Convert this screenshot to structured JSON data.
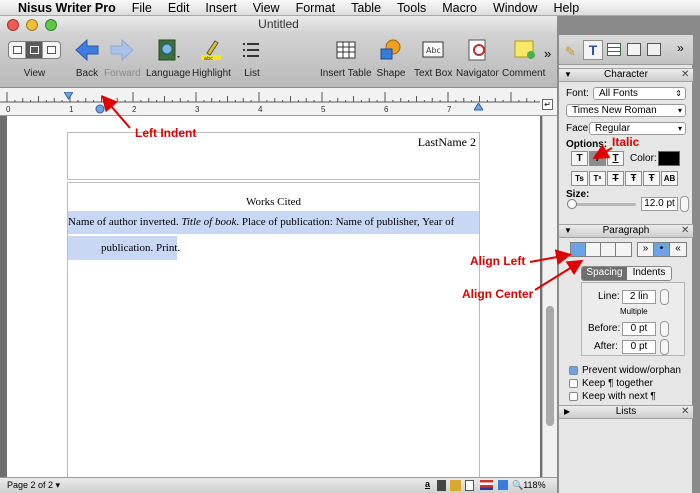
{
  "menubar": {
    "app_name": "Nisus Writer Pro",
    "items": [
      "File",
      "Edit",
      "Insert",
      "View",
      "Format",
      "Table",
      "Tools",
      "Macro",
      "Window",
      "Help"
    ]
  },
  "window": {
    "title": "Untitled",
    "toolbar": {
      "view": "View",
      "back": "Back",
      "forward": "Forward",
      "language": "Language",
      "highlight": "Highlight",
      "list": "List",
      "insert_table": "Insert Table",
      "shape": "Shape",
      "text_box": "Text Box",
      "navigator": "Navigator",
      "comment": "Comment",
      "overflow": "»"
    },
    "ruler_numbers": [
      "0",
      "1",
      "2",
      "3",
      "4",
      "5",
      "6",
      "7"
    ],
    "document": {
      "header_text": "LastName 2",
      "heading": "Works Cited",
      "citation_line1_a": "Name of author inverted. ",
      "citation_line1_title": "Title of book",
      "citation_line1_b": ". Place of publication: Name of publisher, Year of",
      "citation_line2": "publication. Print."
    },
    "status": {
      "page": "Page 2 of 2",
      "zoom": "118%"
    }
  },
  "panel": {
    "character": {
      "title": "Character",
      "font_label": "Font:",
      "font_collection": "All Fonts",
      "font_name": "Times New Roman",
      "face_label": "Face:",
      "face_value": "Regular",
      "options_label": "Options:",
      "color_label": "Color:",
      "size_label": "Size:",
      "size_value": "12.0 pt"
    },
    "paragraph": {
      "title": "Paragraph",
      "tab_spacing": "Spacing",
      "tab_indents": "Indents",
      "line_label": "Line:",
      "line_value": "2 lin",
      "line_mode": "Multiple",
      "before_label": "Before:",
      "before_value": "0 pt",
      "after_label": "After:",
      "after_value": "0 pt",
      "prevent_widow": "Prevent widow/orphan",
      "keep_together": "Keep ¶ together",
      "keep_next": "Keep with next ¶"
    },
    "lists": {
      "title": "Lists"
    }
  },
  "annotations": {
    "left_indent": "Left Indent",
    "italic": "Italic",
    "align_left": "Align Left",
    "align_center": "Align Center"
  },
  "colors": {
    "highlight": "#c8d8f4",
    "annotation": "#e00000",
    "accent_blue": "#5a8fe0"
  }
}
